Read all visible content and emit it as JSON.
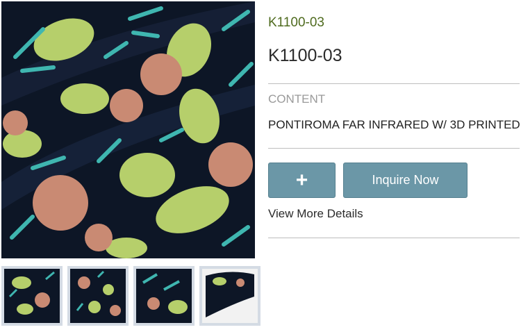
{
  "product": {
    "sku": "K1100-03",
    "title": "K1100-03"
  },
  "content": {
    "label": "CONTENT",
    "value": "PONTIROMA FAR INFRARED W/ 3D PRINTED"
  },
  "actions": {
    "plus_label": "+",
    "inquire_label": "Inquire Now",
    "details_label": "View More Details"
  },
  "colors": {
    "sku_green": "#4f6b1f",
    "button_teal": "#6b97a7",
    "fabric_navy": "#0d1626",
    "flower_lime": "#b6cf6b",
    "flower_teal": "#3fb6b0",
    "flower_salmon": "#c98a73"
  }
}
